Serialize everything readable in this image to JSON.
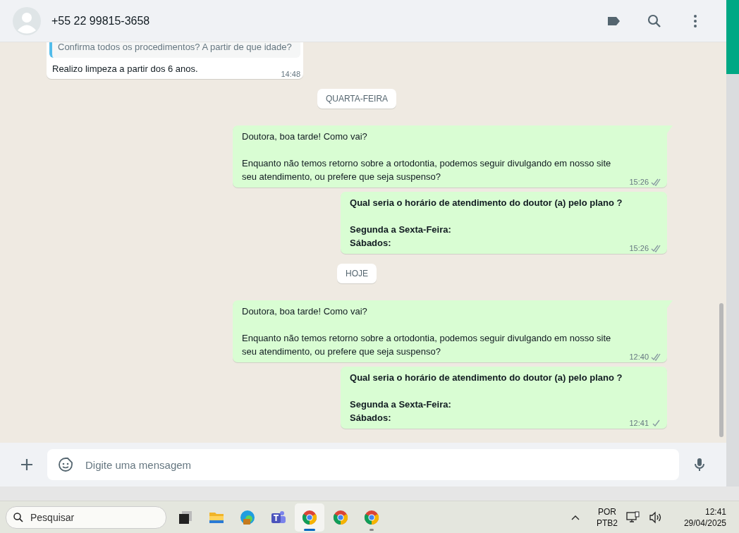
{
  "header": {
    "contact": "+55 22 99815-3658"
  },
  "messages": [
    {
      "kind": "incoming",
      "quote": "Confirma todos os procedimentos? A partir de que idade?",
      "text": "Realizo limpeza a partir dos 6 anos.",
      "time": "14:48"
    },
    {
      "kind": "date",
      "text": "QUARTA-FEIRA"
    },
    {
      "kind": "outgoing",
      "text": "Doutora, boa tarde! Como vai?\n\nEnquanto não temos retorno sobre a ortodontia, podemos seguir divulgando em nosso site seu atendimento, ou prefere que seja suspenso?",
      "time": "15:26",
      "read": true,
      "bold": false,
      "tail": true
    },
    {
      "kind": "outgoing",
      "text": "Qual seria o horário de atendimento do doutor (a) pelo plano ?\n\nSegunda a Sexta-Feira:\nSábados:",
      "time": "15:26",
      "read": true,
      "bold": true,
      "tail": false
    },
    {
      "kind": "date",
      "text": "HOJE"
    },
    {
      "kind": "outgoing",
      "text": "Doutora, boa tarde! Como vai?\n\nEnquanto não temos retorno sobre a ortodontia, podemos seguir divulgando em nosso site seu atendimento, ou prefere que seja suspenso?",
      "time": "12:40",
      "read": true,
      "bold": false,
      "tail": true
    },
    {
      "kind": "outgoing",
      "text": "Qual seria o horário de atendimento do doutor (a) pelo plano ?\n\nSegunda a Sexta-Feira:\nSábados:",
      "time": "12:41",
      "read": false,
      "bold": true,
      "tail": false
    }
  ],
  "composer": {
    "placeholder": "Digite uma mensagem"
  },
  "taskbar": {
    "search": {
      "placeholder": "Pesquisar"
    },
    "apps": [
      {
        "kind": "taskview",
        "active": false,
        "running": false
      },
      {
        "kind": "folder",
        "active": false,
        "running": false
      },
      {
        "kind": "edge",
        "active": false,
        "running": false
      },
      {
        "kind": "teams",
        "active": false,
        "running": false
      },
      {
        "kind": "browser",
        "active": true,
        "running": true
      },
      {
        "kind": "browser",
        "active": false,
        "running": false
      },
      {
        "kind": "browser",
        "active": false,
        "running": true
      }
    ],
    "language": "POR",
    "layout": "PTB2",
    "time": "12:41",
    "date": "29/04/2025"
  }
}
